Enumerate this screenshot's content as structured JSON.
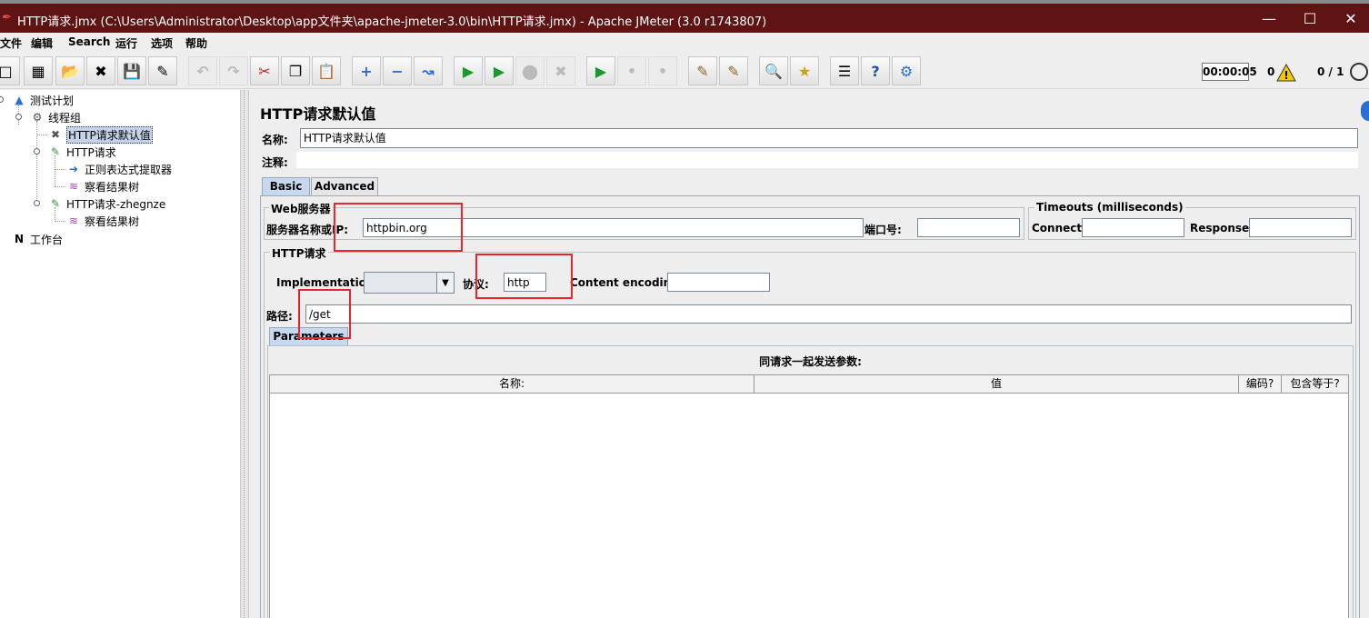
{
  "window": {
    "title": "HTTP请求.jmx (C:\\Users\\Administrator\\Desktop\\app文件夹\\apache-jmeter-3.0\\bin\\HTTP请求.jmx) - Apache JMeter (3.0 r1743807)",
    "minimize": "—",
    "maximize": "☐",
    "close": "✕"
  },
  "menu": [
    "文件",
    "编辑",
    "Search",
    "运行",
    "选项",
    "帮助"
  ],
  "toolbar": {
    "timer": "00:00:05",
    "warnings": "0",
    "threads": "0 / 1"
  },
  "tree": {
    "test_plan": "测试计划",
    "thread_group": "线程组",
    "http_defaults": "HTTP请求默认值",
    "http_request": "HTTP请求",
    "regex_extractor": "正则表达式提取器",
    "results_tree_1": "察看结果树",
    "http_request_2": "HTTP请求-zhegnze",
    "results_tree_2": "察看结果树",
    "workbench": "工作台"
  },
  "panel": {
    "title": "HTTP请求默认值",
    "name_label": "名称:",
    "name_value": "HTTP请求默认值",
    "comment_label": "注释:",
    "comment_value": "",
    "tabs": [
      "Basic",
      "Advanced"
    ],
    "web_server": {
      "title": "Web服务器",
      "server_label": "服务器名称或IP:",
      "server_value": "httpbin.org",
      "port_label": "端口号:",
      "port_value": ""
    },
    "timeouts": {
      "title": "Timeouts (milliseconds)",
      "connect_label": "Connect:",
      "connect_value": "",
      "response_label": "Response:",
      "response_value": ""
    },
    "http_request": {
      "title": "HTTP请求",
      "implementation_label": "Implementation:",
      "implementation_value": "",
      "protocol_label": "协议:",
      "protocol_value": "http",
      "encoding_label": "Content encoding:",
      "encoding_value": "",
      "path_label": "路径:",
      "path_value": "/get"
    },
    "parameters": {
      "tab": "Parameters",
      "caption": "同请求一起发送参数:",
      "columns": [
        "名称:",
        "值",
        "编码?",
        "包含等于?"
      ]
    }
  },
  "colors": {
    "titlebar": "#5f1414",
    "highlight": "#e8262b",
    "selection": "#c4d3ea"
  }
}
